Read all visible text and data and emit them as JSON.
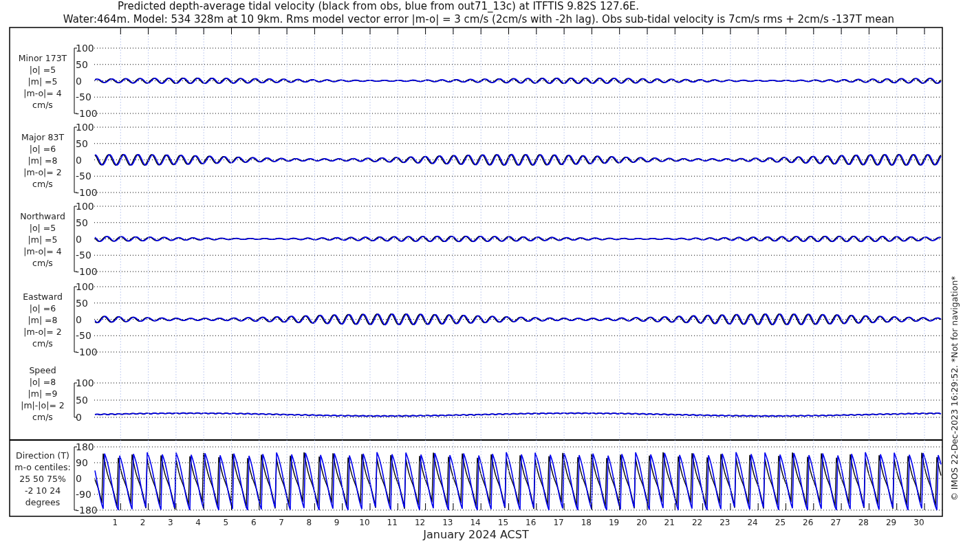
{
  "title_lines": [
    "Predicted depth-average tidal velocity (black from obs, blue from out71_13c) at ITFTIS 9.82S 127.6E.",
    "Water:464m. Model: 534 328m at 10 9km. Rms model vector error |m-o| = 3 cm/s (2cm/s with -2h lag). Obs sub-tidal velocity is 7cm/s rms + 2cm/s -137T mean"
  ],
  "panels": [
    {
      "kind": "velocity",
      "label_lines": [
        "Minor 173T",
        "|o| =5",
        "|m| =5",
        "|m-o|= 4",
        "cm/s"
      ],
      "yticks": [
        "100",
        "50",
        "0",
        "-50",
        "-100"
      ]
    },
    {
      "kind": "velocity",
      "label_lines": [
        "Major 83T",
        "|o| =6",
        "|m| =8",
        "|m-o|= 2",
        "cm/s"
      ],
      "yticks": [
        "100",
        "50",
        "0",
        "-50",
        "-100"
      ]
    },
    {
      "kind": "velocity",
      "label_lines": [
        "Northward",
        "|o| =5",
        "|m| =5",
        "|m-o|= 4",
        "cm/s"
      ],
      "yticks": [
        "100",
        "50",
        "0",
        "-50",
        "-100"
      ]
    },
    {
      "kind": "velocity",
      "label_lines": [
        "Eastward",
        "|o| =6",
        "|m| =8",
        "|m-o|= 2",
        "cm/s"
      ],
      "yticks": [
        "100",
        "50",
        "0",
        "-50",
        "-100"
      ]
    },
    {
      "kind": "speed",
      "label_lines": [
        "Speed",
        "|o| =8",
        "|m| =9",
        "|m|-|o|= 2",
        "cm/s"
      ],
      "yticks": [
        "100",
        "50",
        "0"
      ]
    },
    {
      "kind": "direction",
      "label_lines": [
        "Direction (T)",
        "m-o centiles:",
        "25  50  75%",
        "-2  10  24",
        "degrees"
      ],
      "yticks": [
        "180",
        "90",
        "0",
        "-90",
        "-180"
      ]
    }
  ],
  "x_axis": {
    "day_labels": [
      "1",
      "2",
      "3",
      "4",
      "5",
      "6",
      "7",
      "8",
      "9",
      "10",
      "11",
      "12",
      "13",
      "14",
      "15",
      "16",
      "17",
      "18",
      "19",
      "20",
      "21",
      "22",
      "23",
      "24",
      "25",
      "26",
      "27",
      "28",
      "29",
      "30"
    ],
    "title": "January 2024 ACST"
  },
  "credit": "© IMOS 22-Dec-2023 16:29:52. *Not for navigation*"
}
